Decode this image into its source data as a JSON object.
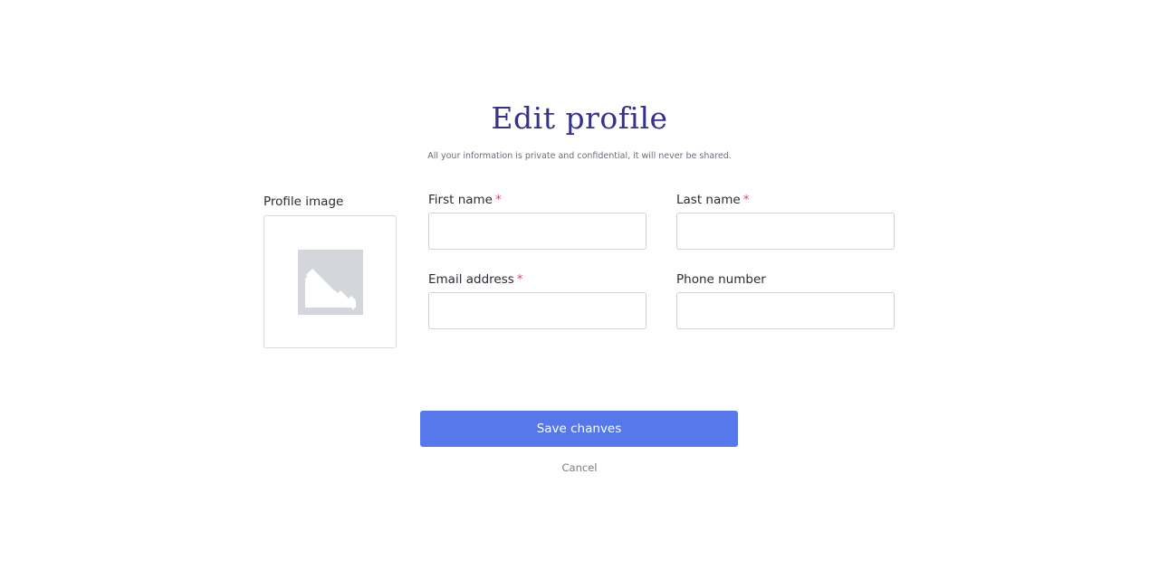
{
  "header": {
    "title": "Edit profile",
    "subtitle": "All your information is private and confidential, it will never be shared."
  },
  "profile_image": {
    "label": "Profile image",
    "icon": "image-placeholder-icon"
  },
  "fields": {
    "first_name": {
      "label": "First name",
      "required_mark": "*",
      "value": "",
      "placeholder": ""
    },
    "last_name": {
      "label": "Last name",
      "required_mark": "*",
      "value": "",
      "placeholder": ""
    },
    "email": {
      "label": "Email address",
      "required_mark": "*",
      "value": "",
      "placeholder": ""
    },
    "phone": {
      "label": "Phone number",
      "value": "",
      "placeholder": ""
    }
  },
  "actions": {
    "save_label": "Save chanves",
    "cancel_label": "Cancel"
  },
  "colors": {
    "title": "#35318f",
    "accent": "#5778ea",
    "required": "#e0457b",
    "placeholder_icon": "#d3d6da"
  }
}
